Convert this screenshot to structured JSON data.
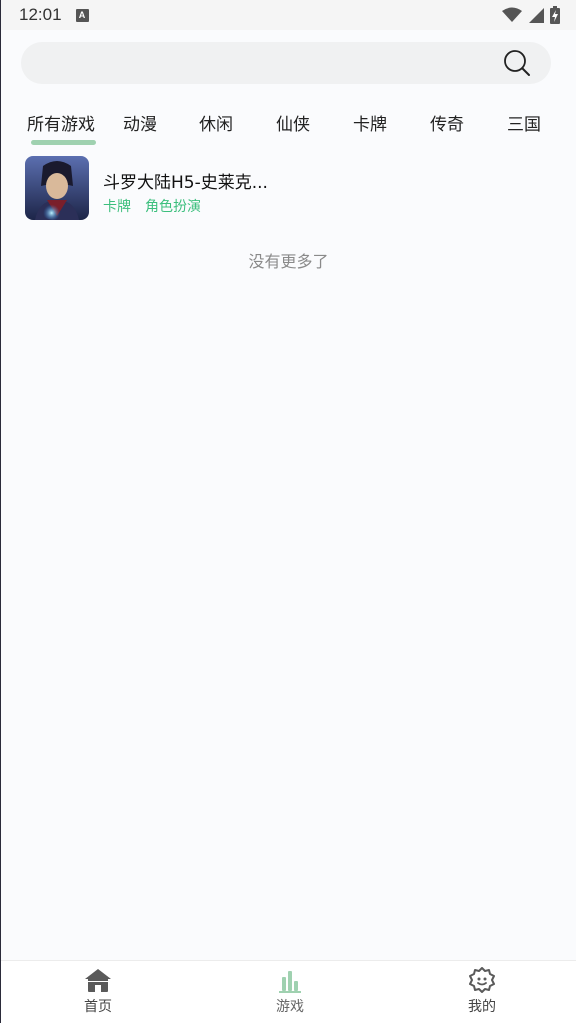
{
  "status_bar": {
    "time": "12:01",
    "notification_icon": "a-icon",
    "indicators": [
      "wifi-icon",
      "signal-icon",
      "battery-icon"
    ]
  },
  "search": {
    "placeholder": "",
    "icon": "search-icon"
  },
  "tabs": [
    {
      "label": "所有游戏",
      "active": true
    },
    {
      "label": "动漫"
    },
    {
      "label": "休闲"
    },
    {
      "label": "仙侠"
    },
    {
      "label": "卡牌"
    },
    {
      "label": "传奇"
    },
    {
      "label": "三国"
    }
  ],
  "games": [
    {
      "title": "斗罗大陆H5-史莱克...",
      "tags": [
        "卡牌",
        "角色扮演"
      ]
    }
  ],
  "list_end_text": "没有更多了",
  "bottom_nav": [
    {
      "label": "首页",
      "icon": "home-icon"
    },
    {
      "label": "游戏",
      "icon": "bar-chart-icon",
      "active": true
    },
    {
      "label": "我的",
      "icon": "profile-icon"
    }
  ],
  "colors": {
    "accent": "#3cbf7d",
    "tab_indicator": "#9fd1b0",
    "background": "#fafbfd"
  }
}
